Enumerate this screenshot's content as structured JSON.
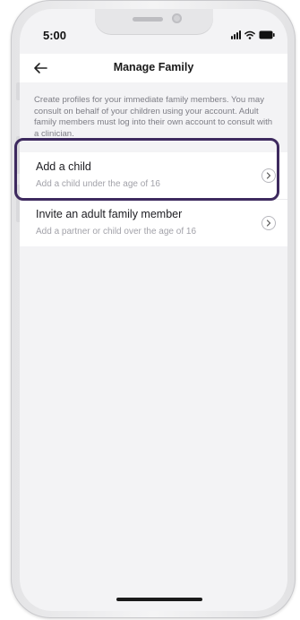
{
  "status_bar": {
    "time": "5:00"
  },
  "header": {
    "title": "Manage Family",
    "back_icon": "arrow-left-icon"
  },
  "description": "Create profiles for your immediate family members. You may consult on behalf of your children using your account. Adult family members must log into their own account to consult with a clinician.",
  "options": [
    {
      "title": "Add a child",
      "subtitle": "Add a child under the age of 16",
      "icon": "chevron-right-icon"
    },
    {
      "title": "Invite an adult family member",
      "subtitle": "Add a partner or child over the age of 16",
      "icon": "chevron-right-icon"
    }
  ],
  "colors": {
    "highlight": "#3e2a5f",
    "background": "#f3f3f5"
  }
}
